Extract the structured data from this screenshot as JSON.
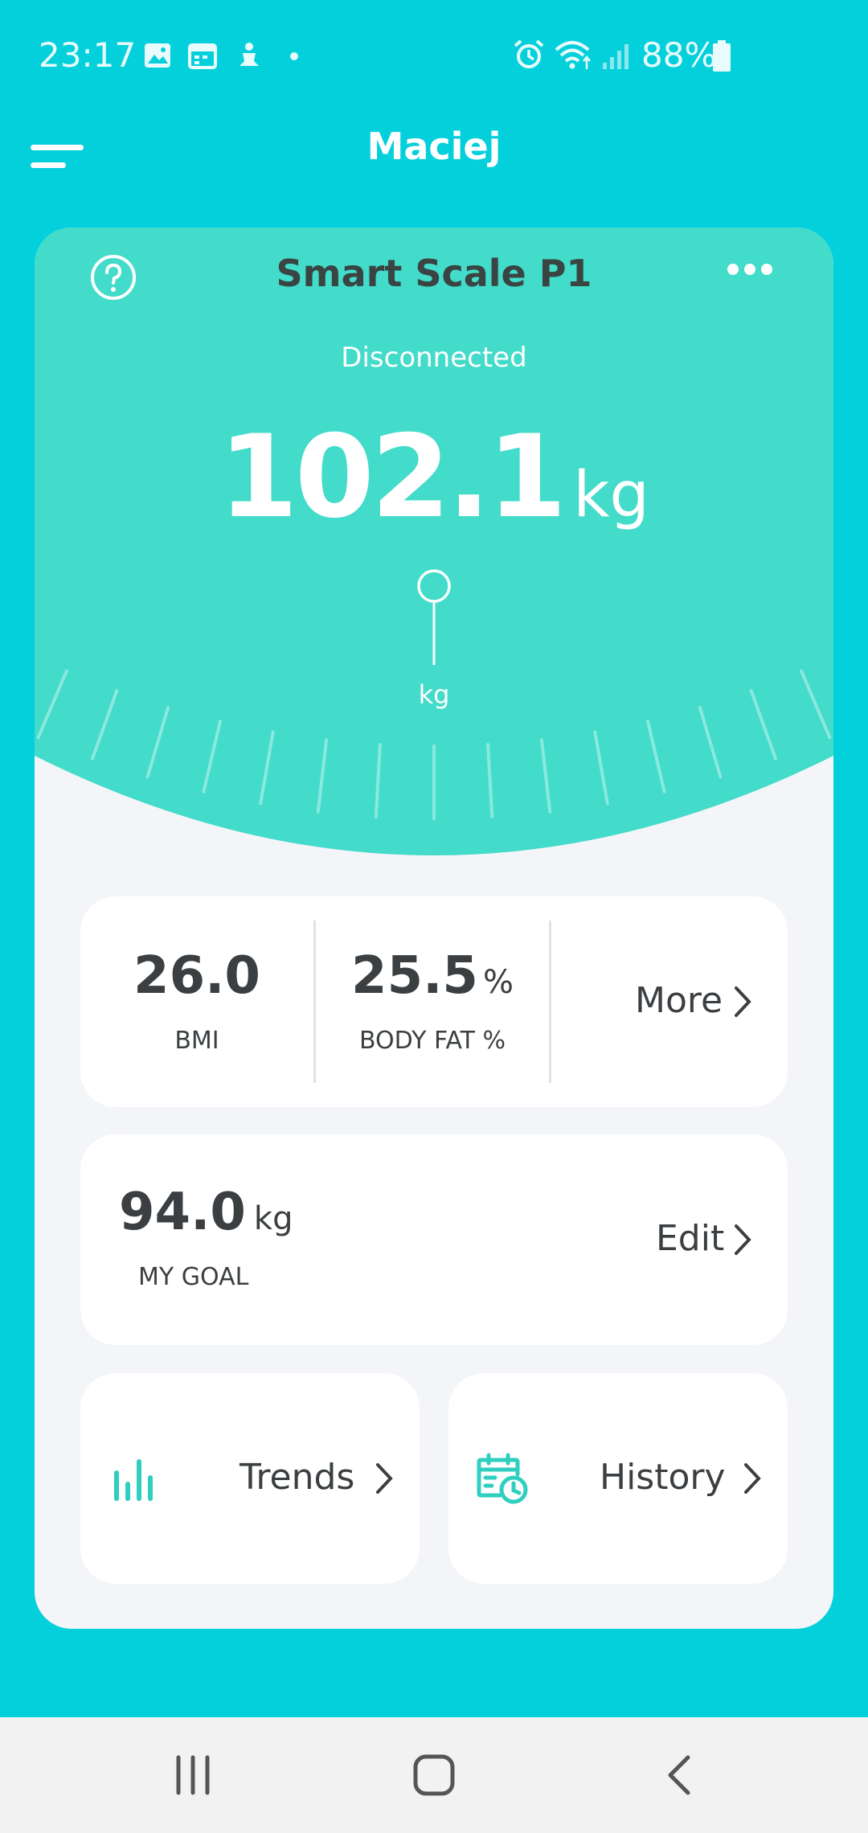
{
  "status_bar": {
    "time": "23:17",
    "battery": "88%",
    "left_icons": [
      "gallery-icon",
      "calendar-icon",
      "meditation-icon",
      "dot-icon"
    ],
    "right_icons": [
      "alarm-icon",
      "wifi-icon",
      "signal-icon",
      "battery-icon"
    ]
  },
  "header": {
    "title": "Maciej"
  },
  "device": {
    "name": "Smart Scale P1",
    "status": "Disconnected",
    "weight": "102.1",
    "weight_unit": "kg",
    "dial_unit": "kg"
  },
  "stats": {
    "bmi_value": "26.0",
    "bmi_label": "BMI",
    "bodyfat_value": "25.5",
    "bodyfat_unit": "%",
    "bodyfat_label": "BODY FAT %",
    "more_label": "More"
  },
  "goal": {
    "value": "94.0",
    "unit": "kg",
    "label": "MY GOAL",
    "edit_label": "Edit"
  },
  "tiles": {
    "trends_label": "Trends",
    "history_label": "History"
  },
  "colors": {
    "background": "#04d0dc",
    "accent": "#43dbca",
    "icon_teal": "#2fcfc0",
    "text_dark": "#3b3f42"
  }
}
